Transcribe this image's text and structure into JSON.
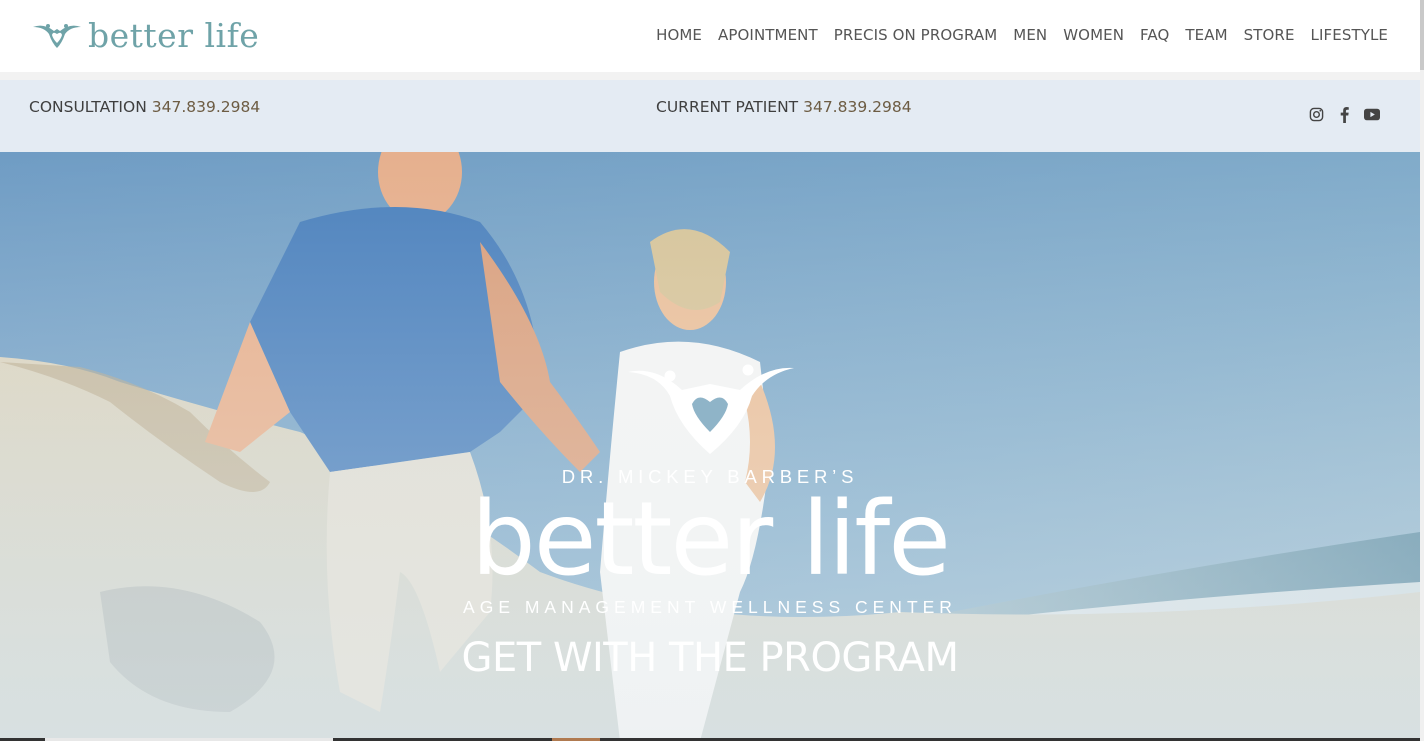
{
  "header": {
    "logo_text": "better life",
    "nav": [
      "HOME",
      "APOINTMENT",
      "PRECIS ON PROGRAM",
      "MEN",
      "WOMEN",
      "FAQ",
      "TEAM",
      "STORE",
      "LIFESTYLE"
    ]
  },
  "contact_bar": {
    "consultation_label": "CONSULTATION",
    "consultation_phone": "347.839.2984",
    "patient_label": "CURRENT PATIENT",
    "patient_phone": "347.839.2984",
    "social_icons": [
      "instagram-icon",
      "facebook-icon",
      "youtube-icon"
    ]
  },
  "hero": {
    "image_subject": "older couple running hand in hand on a sand dune by the ocean",
    "dr_line": "DR. MICKEY BARBER’S",
    "brand": "better life",
    "subtitle": "AGE MANAGEMENT WELLNESS CENTER",
    "cta": "GET WITH THE PROGRAM"
  },
  "colors": {
    "logo_teal": "#6fa3a8",
    "nav_text": "#555555",
    "contact_bar_bg": "#e4ebf3",
    "phone_text": "#6d5c43",
    "sky": "#7aa6c8",
    "sand": "#d8d2bf"
  }
}
